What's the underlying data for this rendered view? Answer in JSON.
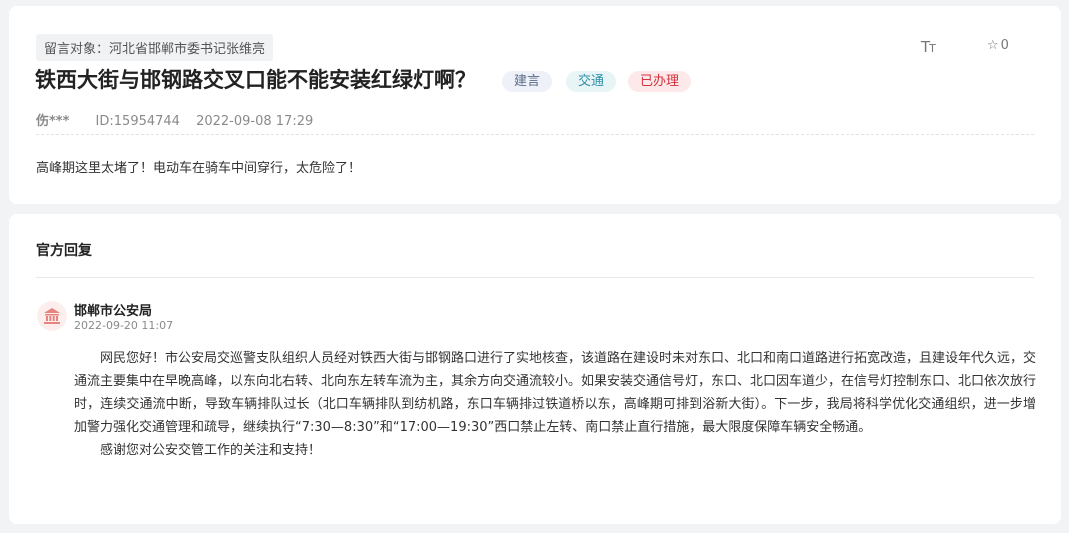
{
  "message": {
    "target_label": "留言对象：河北省邯郸市委书记张维亮",
    "title": "铁西大街与邯钢路交叉口能不能安装红绿灯啊？",
    "tags": [
      {
        "label": "建言",
        "color": "#5c6b8a"
      },
      {
        "label": "交通",
        "color": "#2f8fa8"
      },
      {
        "label": "已办理",
        "color": "#d2333d"
      }
    ],
    "font_size_icon": "font-size-icon",
    "favorite_icon": "star-icon",
    "favorite_count": "0",
    "author": "伤***",
    "id_label": "ID:15954744",
    "date": "2022-09-08 17:29",
    "content": "高峰期这里太堵了！电动车在骑车中间穿行，太危险了！"
  },
  "reply": {
    "heading": "官方回复",
    "department_icon": "government-building-icon",
    "department": "邯郸市公安局",
    "time": "2022-09-20 11:07",
    "paragraphs": [
      "网民您好！市公安局交巡警支队组织人员经对铁西大街与邯钢路口进行了实地核查，该道路在建设时未对东口、北口和南口道路进行拓宽改造，且建设年代久远，交通流主要集中在早晚高峰，以东向北右转、北向东左转车流为主，其余方向交通流较小。如果安装交通信号灯，东口、北口因车道少，在信号灯控制东口、北口依次放行时，连续交通流中断，导致车辆排队过长（北口车辆排队到纺机路，东口车辆排过铁道桥以东，高峰期可排到浴新大街）。下一步，我局将科学优化交通组织，进一步增加警力强化交通管理和疏导，继续执行“7:30—8:30”和“17:00—19:30”西口禁止左转、南口禁止直行措施，最大限度保障车辆安全畅通。",
      "感谢您对公安交管工作的关注和支持！"
    ]
  }
}
